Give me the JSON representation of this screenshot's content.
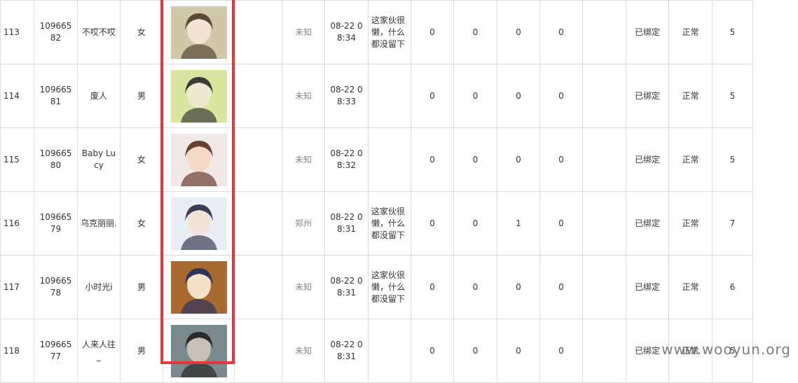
{
  "rows": [
    {
      "idx": "113",
      "uid": "10966582",
      "name": "不哎不哎",
      "gender": "女",
      "location": "未知",
      "time": "08-22 08:34",
      "bio": "这家伙很懒，什么都没留下",
      "c1": "0",
      "c2": "0",
      "c3": "0",
      "c4": "0",
      "bind": "已绑定",
      "status": "正常",
      "level": "5"
    },
    {
      "idx": "114",
      "uid": "10966581",
      "name": "废人",
      "gender": "男",
      "location": "未知",
      "time": "08-22 08:33",
      "bio": "",
      "c1": "0",
      "c2": "0",
      "c3": "0",
      "c4": "0",
      "bind": "已绑定",
      "status": "正常",
      "level": "5"
    },
    {
      "idx": "115",
      "uid": "10966580",
      "name": "Baby Lucy",
      "gender": "女",
      "location": "未知",
      "time": "08-22 08:32",
      "bio": "",
      "c1": "0",
      "c2": "0",
      "c3": "0",
      "c4": "0",
      "bind": "已绑定",
      "status": "正常",
      "level": "5"
    },
    {
      "idx": "116",
      "uid": "10966579",
      "name": "乌克丽丽.",
      "gender": "女",
      "location": "郑州",
      "time": "08-22 08:31",
      "bio": "这家伙很懒，什么都没留下",
      "c1": "0",
      "c2": "0",
      "c3": "1",
      "c4": "0",
      "bind": "已绑定",
      "status": "正常",
      "level": "7"
    },
    {
      "idx": "117",
      "uid": "10966578",
      "name": "小时光i",
      "gender": "男",
      "location": "未知",
      "time": "08-22 08:31",
      "bio": "这家伙很懒，什么都没留下",
      "c1": "0",
      "c2": "0",
      "c3": "0",
      "c4": "0",
      "bind": "已绑定",
      "status": "正常",
      "level": "6"
    },
    {
      "idx": "118",
      "uid": "10966577",
      "name": "人来人往_",
      "gender": "男",
      "location": "未知",
      "time": "08-22 08:31",
      "bio": "",
      "c1": "0",
      "c2": "0",
      "c3": "0",
      "c4": "0",
      "bind": "已绑定",
      "status": "正常",
      "level": "5"
    }
  ],
  "watermark": "www.wooyun.org",
  "colors": {
    "highlight": "#e8343a",
    "border": "#dcdcdc"
  }
}
